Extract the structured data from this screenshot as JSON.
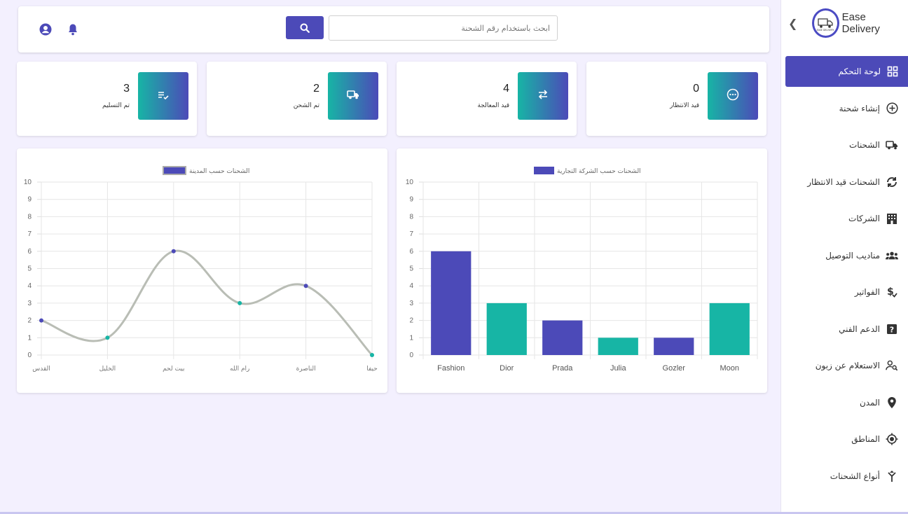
{
  "app": {
    "name": "Ease Delivery",
    "logo_text": "EASE DELIVERY"
  },
  "sidebar": {
    "collapse_icon": "chevron-left-icon",
    "items": [
      {
        "label": "لوحة التحكم",
        "icon": "dashboard-grid-icon",
        "active": true
      },
      {
        "label": "إنشاء شحنة",
        "icon": "plus-circle-icon"
      },
      {
        "label": "الشحنات",
        "icon": "truck-icon"
      },
      {
        "label": "الشحنات قيد الانتظار",
        "icon": "sync-icon"
      },
      {
        "label": "الشركات",
        "icon": "building-icon"
      },
      {
        "label": "مناديب التوصيل",
        "icon": "users-icon"
      },
      {
        "label": "الفواتير",
        "icon": "invoice-dollar-icon"
      },
      {
        "label": "الدعم الفني",
        "icon": "help-box-icon"
      },
      {
        "label": "الاستعلام عن زبون",
        "icon": "person-search-icon"
      },
      {
        "label": "المدن",
        "icon": "location-pin-icon"
      },
      {
        "label": "المناطق",
        "icon": "target-icon"
      },
      {
        "label": "أنواع الشحنات",
        "icon": "merge-icon"
      }
    ]
  },
  "header": {
    "search_placeholder": "ابحث باستخدام رقم الشحنة",
    "search_button_icon": "search-icon",
    "user_icon": "account-icon",
    "bell_icon": "bell-icon"
  },
  "stats": [
    {
      "value": "0",
      "label": "قيد الانتظار",
      "icon": "dots-circle-icon"
    },
    {
      "value": "4",
      "label": "قيد المعالجة",
      "icon": "swap-icon"
    },
    {
      "value": "2",
      "label": "تم الشحن",
      "icon": "truck-icon"
    },
    {
      "value": "3",
      "label": "تم التسليم",
      "icon": "list-check-icon"
    }
  ],
  "colors": {
    "primary": "#4c4ab8",
    "teal": "#17b5a5",
    "line": "#b9bdb5"
  },
  "chart_data": [
    {
      "type": "bar",
      "legend": "الشحنات حسب الشركة التجارية",
      "categories": [
        "Fashion",
        "Dior",
        "Prada",
        "Julia",
        "Gozler",
        "Moon"
      ],
      "values": [
        6,
        3,
        2,
        1,
        1,
        3
      ],
      "ylim": [
        0,
        10
      ],
      "yticks": [
        0,
        1,
        2,
        3,
        4,
        5,
        6,
        7,
        8,
        9,
        10
      ],
      "bar_colors": [
        "#4c4ab8",
        "#17b5a5",
        "#4c4ab8",
        "#17b5a5",
        "#4c4ab8",
        "#17b5a5"
      ],
      "grid": true,
      "legend_position": "top"
    },
    {
      "type": "line",
      "legend": "الشحنات حسب المدينة",
      "categories": [
        "القدس",
        "الخليل",
        "بيت لحم",
        "رام الله",
        "الناصرة",
        "حيفا"
      ],
      "values": [
        2,
        1,
        6,
        3,
        4,
        0
      ],
      "ylim": [
        0,
        10
      ],
      "yticks": [
        0,
        1,
        2,
        3,
        4,
        5,
        6,
        7,
        8,
        9,
        10
      ],
      "point_colors": [
        "#4c4ab8",
        "#17b5a5",
        "#4c4ab8",
        "#17b5a5",
        "#4c4ab8",
        "#17b5a5"
      ],
      "grid": true,
      "legend_position": "top"
    }
  ]
}
